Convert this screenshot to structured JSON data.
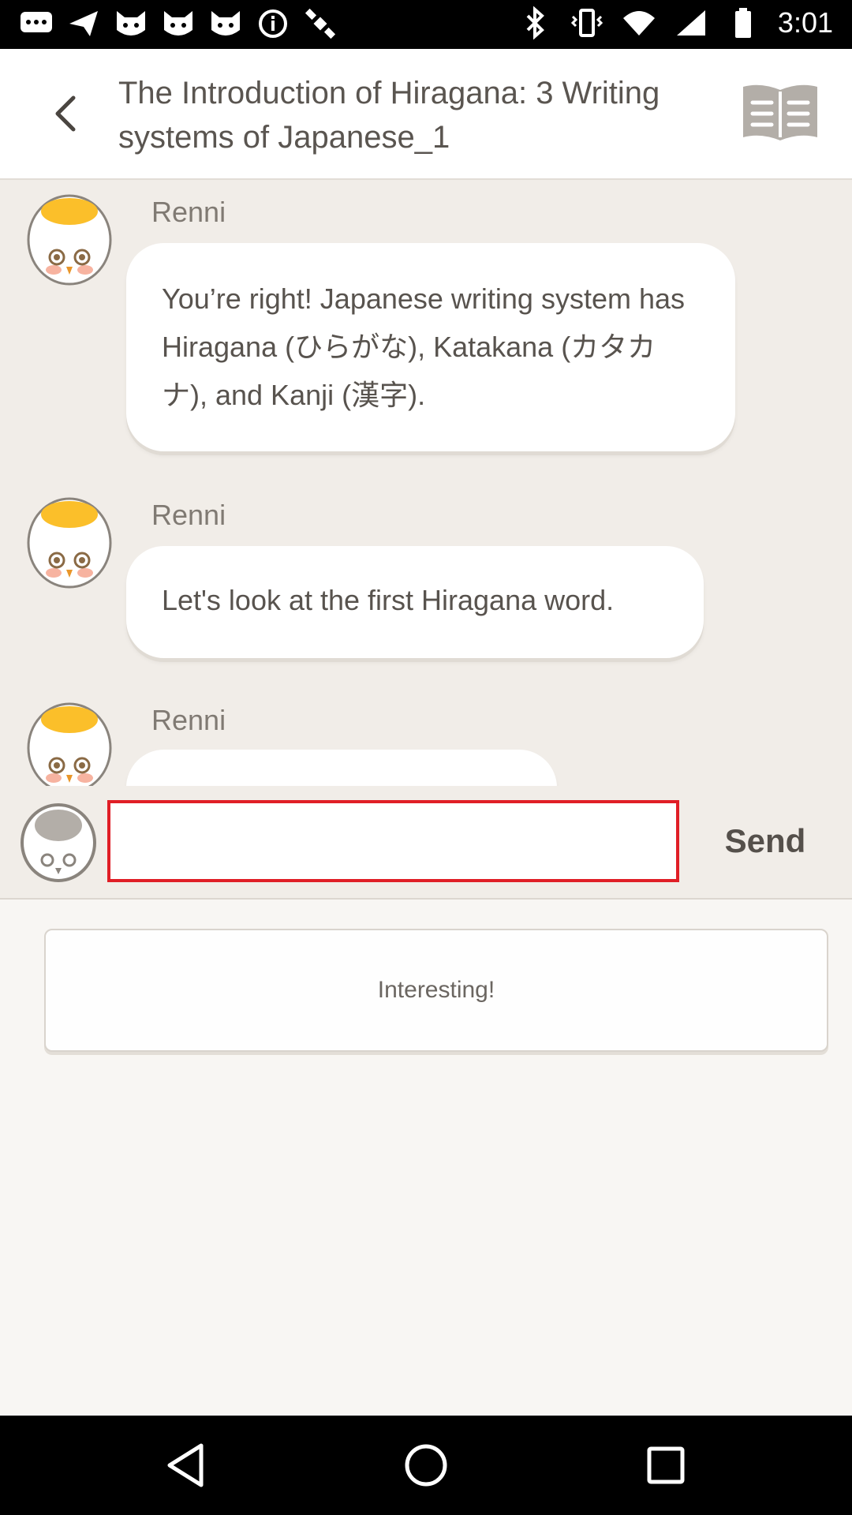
{
  "status_bar": {
    "time": "3:01",
    "left_icons": [
      "chat-icon",
      "send-icon",
      "cat-icon",
      "cat-icon",
      "cat-icon",
      "info-icon",
      "satellite-icon"
    ],
    "right_icons": [
      "bluetooth-icon",
      "vibrate-icon",
      "wifi-icon",
      "signal-icon",
      "battery-icon"
    ]
  },
  "header": {
    "back_icon": "chevron-left-icon",
    "title": "The Introduction of Hiragana: 3 Writing systems of Japanese_1",
    "book_icon": "book-icon"
  },
  "messages": [
    {
      "sender": "Renni",
      "text": "You’re right! Japanese writing system has Hiragana (ひらがな), Katakana (カタカナ), and Kanji (漢字)."
    },
    {
      "sender": "Renni",
      "text": "Let's look at the first Hiragana word."
    },
    {
      "sender": "Renni",
      "text": ""
    }
  ],
  "input": {
    "value": "",
    "placeholder": ""
  },
  "send_label": "Send",
  "suggested_reply": "Interesting!",
  "nav": {
    "back_icon": "triangle-back-icon",
    "home_icon": "circle-home-icon",
    "recents_icon": "square-recents-icon"
  },
  "colors": {
    "input_border": "#e01e26",
    "chat_bg": "#f1ede8",
    "accent_yolk": "#fbbf2a"
  }
}
